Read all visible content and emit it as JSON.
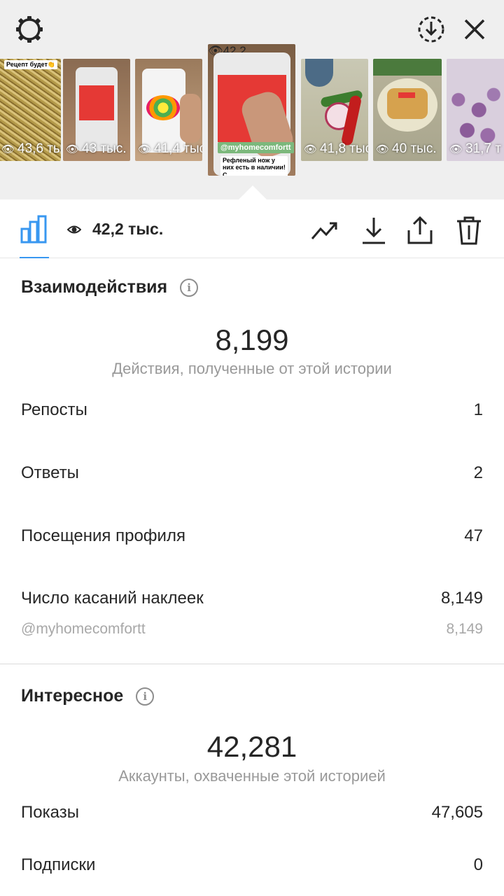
{
  "top_bar": {
    "icons": [
      "gear-icon",
      "download-circle-icon",
      "close-icon"
    ]
  },
  "thumbnails": [
    {
      "overlay": "Рецепт будет👏",
      "views": "43,6 ты"
    },
    {
      "views": "43 тыс."
    },
    {
      "views": "41,4 тыс"
    },
    {
      "active": true,
      "handle": "@myhomecomfortt",
      "caption": "Рефленый нож у них есть в наличии!С.",
      "views": "42,2"
    },
    {
      "views": "41,8 тыс"
    },
    {
      "views": "40 тыс."
    },
    {
      "views": "31,7 т"
    }
  ],
  "toolbar": {
    "views_total": "42,2 тыс.",
    "icons": [
      "bar-chart-icon",
      "eye-icon",
      "trend-icon",
      "download-icon",
      "share-icon",
      "trash-icon"
    ],
    "accent": "#3897f0"
  },
  "interactions": {
    "title": "Взаимодействия",
    "total": "8,199",
    "subtitle": "Действия, полученные от этой истории",
    "rows": [
      {
        "label": "Репосты",
        "value": "1"
      },
      {
        "label": "Ответы",
        "value": "2"
      },
      {
        "label": "Посещения профиля",
        "value": "47"
      },
      {
        "label": "Число касаний наклеек",
        "value": "8,149"
      }
    ],
    "sub_row": {
      "label": "@myhomecomfortt",
      "value": "8,149"
    }
  },
  "discovery": {
    "title": "Интересное",
    "total": "42,281",
    "subtitle": "Аккаунты, охваченные этой историей",
    "rows": [
      {
        "label": "Показы",
        "value": "47,605"
      },
      {
        "label": "Подписки",
        "value": "0"
      }
    ]
  }
}
